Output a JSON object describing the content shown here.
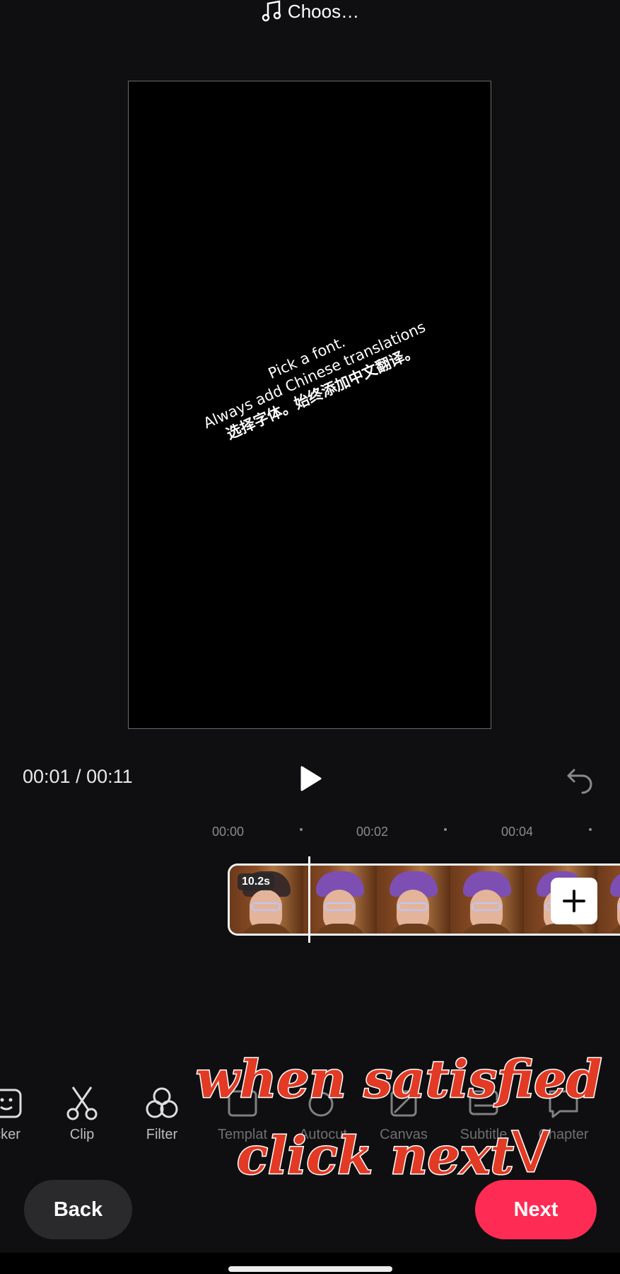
{
  "header": {
    "music_label": "Choos…",
    "music_icon": "music-note-icon"
  },
  "preview": {
    "overlay_lines": [
      "Pick a font.",
      "Always add Chinese translations",
      "选择字体。始终添加中文翻译。"
    ]
  },
  "transport": {
    "time": "00:01 / 00:11",
    "play_icon": "play-icon",
    "undo_icon": "undo-icon"
  },
  "ruler": {
    "ticks": [
      "00:00",
      "00:02",
      "00:04"
    ]
  },
  "timeline": {
    "duration_badge": "10.2s",
    "add_icon": "plus-icon"
  },
  "toolbar": {
    "items": [
      {
        "label": "cker",
        "icon": "sticker-icon"
      },
      {
        "label": "Clip",
        "icon": "scissors-icon"
      },
      {
        "label": "Filter",
        "icon": "filter-icon"
      },
      {
        "label": "Templat",
        "icon": "template-icon"
      },
      {
        "label": "Autocut",
        "icon": "autocut-icon"
      },
      {
        "label": "Canvas",
        "icon": "canvas-icon"
      },
      {
        "label": "Subtitle",
        "icon": "subtitle-icon"
      },
      {
        "label": "Chapter",
        "icon": "chapter-icon"
      }
    ]
  },
  "annotation": {
    "line1": "when satisfied",
    "line2": "click next",
    "mark": "V"
  },
  "buttons": {
    "back": "Back",
    "next": "Next"
  },
  "colors": {
    "next_button": "#fe2c55",
    "annotation": "#e23a24",
    "background": "#0f0f11"
  }
}
